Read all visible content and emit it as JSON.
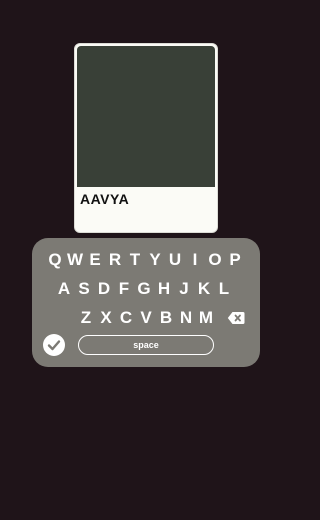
{
  "card": {
    "name": "AAVYA",
    "image_color": "#394037",
    "background_color": "#fbfbf6"
  },
  "keyboard": {
    "rows": [
      [
        "Q",
        "W",
        "E",
        "R",
        "T",
        "Y",
        "U",
        "I",
        "O",
        "P"
      ],
      [
        "A",
        "S",
        "D",
        "F",
        "G",
        "H",
        "J",
        "K",
        "L"
      ],
      [
        "Z",
        "X",
        "C",
        "V",
        "B",
        "N",
        "M"
      ]
    ],
    "space_label": "space",
    "backspace_icon": "backspace-icon",
    "done_icon": "checkmark-icon",
    "background_color": "#7c7a74"
  },
  "page": {
    "background_color": "#1f1419"
  }
}
